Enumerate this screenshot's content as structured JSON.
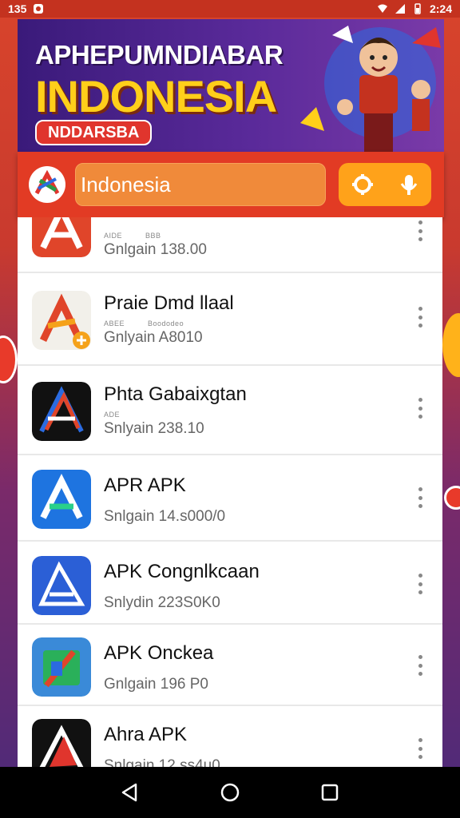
{
  "status_bar": {
    "time": "135",
    "clock": "2:24"
  },
  "banner": {
    "title": "APHEPUMNDIABAR",
    "subtitle": "INDONESIA",
    "badge": "NDDARSBA"
  },
  "search": {
    "value": "Indonesia"
  },
  "apps": [
    {
      "name": "",
      "meta": [
        "AIDE",
        "BBB"
      ],
      "size": "Gnlgain 138.00",
      "icon": "red-a-icon"
    },
    {
      "name": "Praie Dmd llaal",
      "meta": [
        "ABEE",
        "Boododeo"
      ],
      "size": "Gnlyain A8010",
      "icon": "orange-a-plus-icon"
    },
    {
      "name": "Phta Gabaixgtan",
      "meta": [
        "ADE"
      ],
      "size": "Snlyain 238.10",
      "icon": "dark-a-icon"
    },
    {
      "name": "APR APK",
      "meta": [],
      "size": "Snlgain 14.s000/0",
      "icon": "blue-a-icon"
    },
    {
      "name": "APK Congnlkcaan",
      "meta": [],
      "size": "Snlydin 223S0K0",
      "icon": "blue-outline-a-icon"
    },
    {
      "name": "APK Onckea",
      "meta": [],
      "size": "Gnlgain 196 P0",
      "icon": "bag-a-icon"
    },
    {
      "name": "Ahra APK",
      "meta": [],
      "size": "Snlgain 12.ss4u0",
      "icon": "black-a-icon"
    }
  ],
  "colors": {
    "accent": "#e23b24",
    "search_field": "#f08a3a",
    "action_group": "#ffa21a",
    "banner_yellow": "#ffcf1a"
  }
}
